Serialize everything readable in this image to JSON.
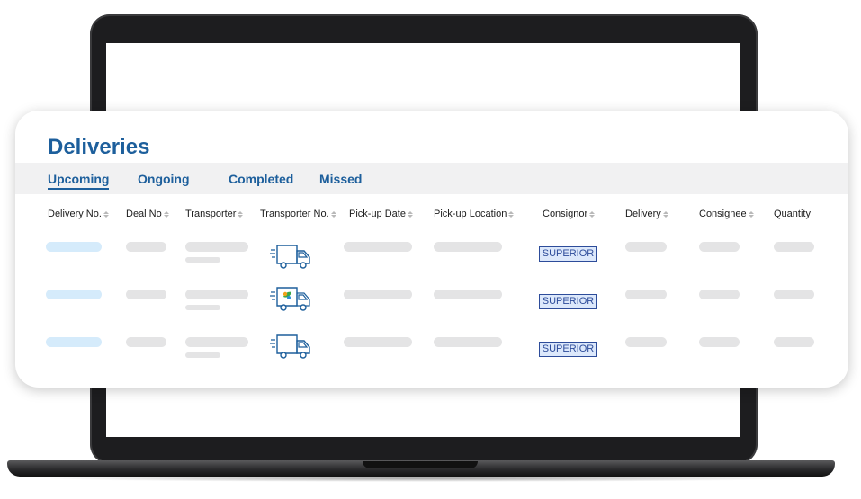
{
  "page": {
    "title": "Deliveries"
  },
  "tabs": [
    {
      "label": "Upcoming",
      "active": true
    },
    {
      "label": "Ongoing",
      "active": false
    },
    {
      "label": "Completed",
      "active": false
    },
    {
      "label": "Missed",
      "active": false
    }
  ],
  "table": {
    "columns": [
      "Delivery No.",
      "Deal No",
      "Transporter",
      "Transporter No.",
      "Pick-up Date",
      "Pick-up Location",
      "Consignor",
      "Delivery",
      "Consignee",
      "Quantity"
    ],
    "rows": [
      {
        "consignor_badge": "SUPERIOR",
        "transporter_icon": "truck-icon"
      },
      {
        "consignor_badge": "SUPERIOR",
        "transporter_icon": "truck-icon-with-leaf"
      },
      {
        "consignor_badge": "SUPERIOR",
        "transporter_icon": "truck-icon"
      }
    ]
  },
  "colors": {
    "accent": "#1d5f9c",
    "badge_border": "#2d4c9a",
    "badge_bg": "#dce8fb",
    "placeholder": "#e4e4e5",
    "placeholder_blue": "#d5ebfb"
  }
}
